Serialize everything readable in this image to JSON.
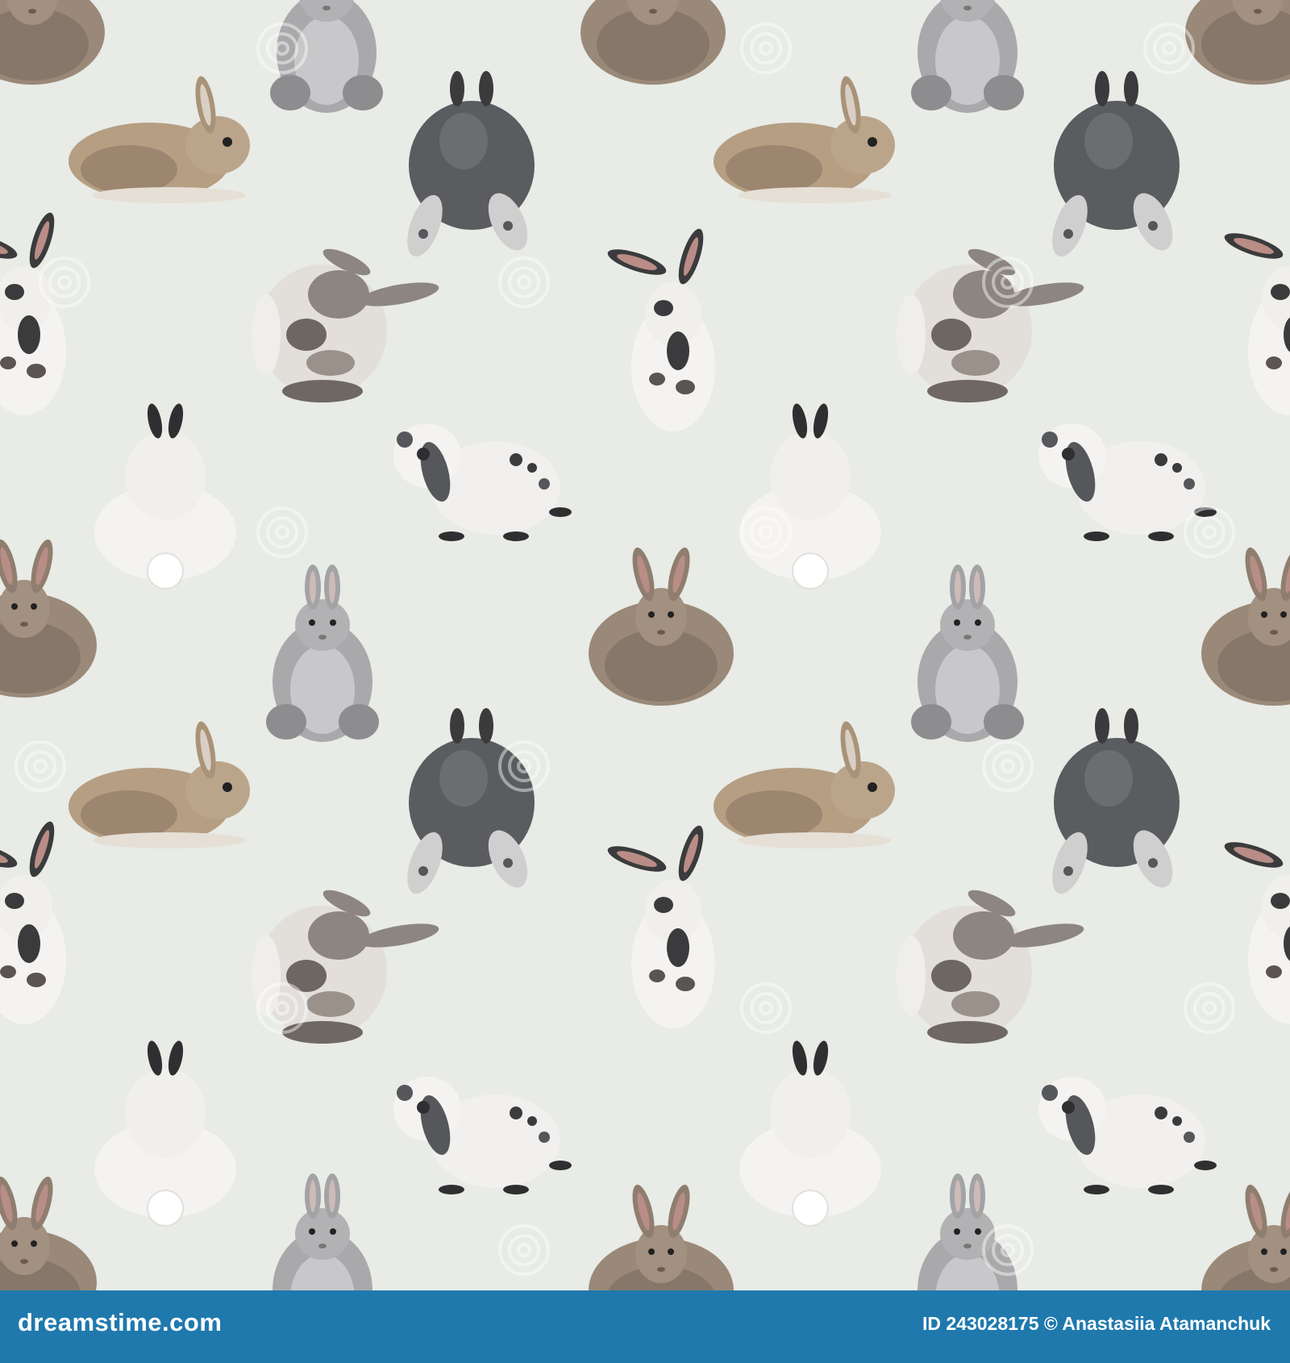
{
  "image": {
    "subject": "seamless-rabbit-pattern",
    "background_color": "#e8ebe6",
    "palette": {
      "brown": "#9a8978",
      "brown_dark": "#6f5f52",
      "tan": "#b59e82",
      "grey": "#a9a9ab",
      "dark_grey": "#5a5c60",
      "white": "#f4f3f1",
      "spot": "#3b3b3d",
      "ear_inner": "#b98d86"
    },
    "watermark_icon": "swirl-watermark-icon"
  },
  "footer": {
    "brand": "dreamstime.com",
    "credit": "ID 243028175 © Anastasiia Atamanchuk",
    "bar_color": "#1f79ad"
  }
}
